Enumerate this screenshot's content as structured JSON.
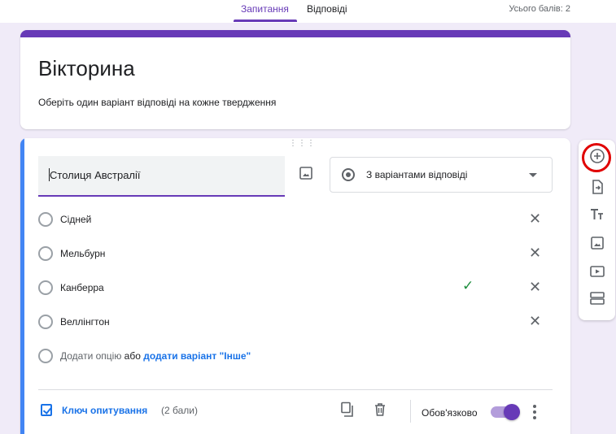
{
  "header": {
    "tabs": [
      {
        "label": "Запитання",
        "active": true
      },
      {
        "label": "Відповіді",
        "active": false
      }
    ],
    "total_points": "Усього балів: 2"
  },
  "form": {
    "title": "Вікторина",
    "description": "Оберіть один варіант відповіді на кожне твердження"
  },
  "question": {
    "title": "Столиця Австралії",
    "type_label": "З варіантами відповіді",
    "options": [
      {
        "label": "Сідней",
        "correct": false
      },
      {
        "label": "Мельбурн",
        "correct": false
      },
      {
        "label": "Канберра",
        "correct": true
      },
      {
        "label": "Веллінгтон",
        "correct": false
      }
    ],
    "add_option": "Додати опцію",
    "or": "або",
    "add_other": "додати варіант \"Інше\"",
    "answer_key": "Ключ опитування",
    "points": "(2 бали)",
    "required_label": "Обов'язково",
    "required": true
  },
  "toolbar": {
    "items": [
      "add-question-icon",
      "import-questions-icon",
      "add-title-icon",
      "add-image-icon",
      "add-video-icon",
      "add-section-icon"
    ]
  },
  "colors": {
    "accent": "#673ab7",
    "focus_bar": "#4285f4",
    "link": "#1a73e8",
    "correct": "#1e8e3e",
    "highlight_ring": "#e00000"
  }
}
